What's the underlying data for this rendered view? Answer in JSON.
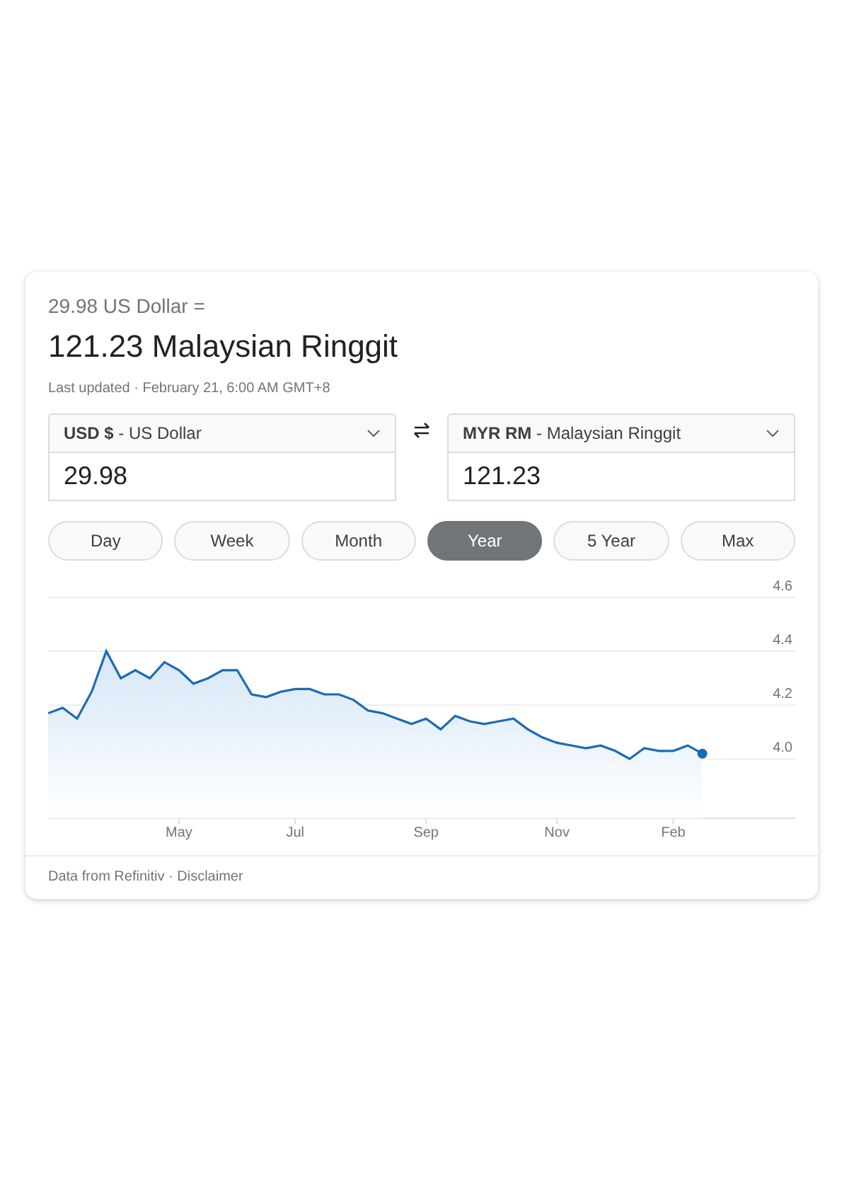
{
  "header": {
    "source_amount": "29.98 US Dollar =",
    "result": "121.23 Malaysian Ringgit",
    "last_updated": "Last updated · February 21, 6:00 AM GMT+8"
  },
  "converter": {
    "from": {
      "code": "USD $",
      "name": " - US Dollar",
      "value": "29.98"
    },
    "to": {
      "code": "MYR RM",
      "name": " - Malaysian Ringgit",
      "value": "121.23"
    }
  },
  "ranges": [
    {
      "label": "Day",
      "selected": false
    },
    {
      "label": "Week",
      "selected": false
    },
    {
      "label": "Month",
      "selected": false
    },
    {
      "label": "Year",
      "selected": true
    },
    {
      "label": "5 Year",
      "selected": false
    },
    {
      "label": "Max",
      "selected": false
    }
  ],
  "chart_data": {
    "type": "area",
    "grid": true,
    "categories": [
      null,
      null,
      null,
      null,
      null,
      null,
      null,
      null,
      null,
      "May",
      null,
      null,
      null,
      null,
      null,
      null,
      null,
      "Jul",
      null,
      null,
      null,
      null,
      null,
      null,
      null,
      null,
      "Sep",
      null,
      null,
      null,
      null,
      null,
      null,
      null,
      null,
      "Nov",
      null,
      null,
      null,
      null,
      null,
      null,
      null,
      "Feb",
      null,
      null
    ],
    "series": [
      {
        "color": "#1a6bb5",
        "values": [
          4.17,
          4.19,
          4.15,
          4.25,
          4.4,
          4.3,
          4.33,
          4.3,
          4.36,
          4.33,
          4.28,
          4.3,
          4.33,
          4.33,
          4.24,
          4.23,
          4.25,
          4.26,
          4.26,
          4.24,
          4.24,
          4.22,
          4.18,
          4.17,
          4.15,
          4.13,
          4.15,
          4.11,
          4.16,
          4.14,
          4.13,
          4.14,
          4.15,
          4.11,
          4.08,
          4.06,
          4.05,
          4.04,
          4.05,
          4.03,
          4.0,
          4.04,
          4.03,
          4.03,
          4.05,
          4.02
        ]
      }
    ],
    "ylim": [
      3.78,
      4.6
    ],
    "yticks": [
      {
        "value": 4.0,
        "label": "4.0"
      },
      {
        "value": 4.2,
        "label": "4.2"
      },
      {
        "value": 4.4,
        "label": "4.4"
      },
      {
        "value": 4.6,
        "label": "4.6"
      }
    ]
  },
  "footer": {
    "text": "Data from Refinitiv · ",
    "link": "Disclaimer"
  }
}
